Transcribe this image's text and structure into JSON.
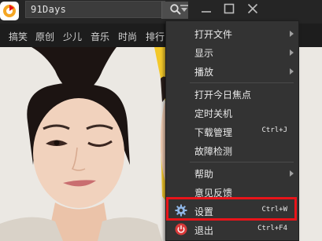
{
  "app": {
    "search_value": "91Days"
  },
  "categories": [
    "搞笑",
    "原创",
    "少儿",
    "音乐",
    "时尚",
    "排行"
  ],
  "menu": {
    "items": [
      {
        "label": "打开文件",
        "submenu": true
      },
      {
        "label": "显示",
        "submenu": true
      },
      {
        "label": "播放",
        "submenu": true
      },
      {
        "label": "打开今日焦点"
      },
      {
        "label": "定时关机"
      },
      {
        "label": "下载管理",
        "shortcut": "Ctrl+J"
      },
      {
        "label": "故障检测"
      },
      {
        "label": "帮助",
        "submenu": true
      },
      {
        "label": "意见反馈"
      },
      {
        "label": "设置",
        "shortcut": "Ctrl+W",
        "icon": "gear-icon",
        "highlighted": true
      },
      {
        "label": "退出",
        "shortcut": "Ctrl+F4",
        "icon": "power-icon"
      }
    ]
  },
  "colors": {
    "highlight_border": "#e8141a",
    "exit_icon": "#d93a3a",
    "menu_bg": "#333333"
  }
}
